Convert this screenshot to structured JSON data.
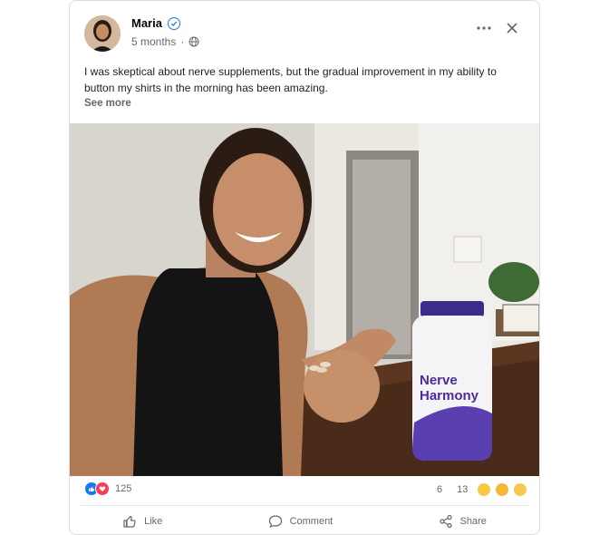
{
  "post": {
    "author": "Maria",
    "time": "5 months",
    "separator": "·",
    "text": "I was skeptical about nerve supplements, but the gradual improvement in my ability to button my shirts in the morning has been amazing.",
    "see_more": "See more"
  },
  "photo": {
    "bottle_line1": "Nerve",
    "bottle_line2": "Harmony"
  },
  "stats": {
    "reaction_count": "125",
    "comments_count": "6",
    "shares_count": "13"
  },
  "actions": {
    "like": "Like",
    "comment": "Comment",
    "share": "Share"
  },
  "colors": {
    "accent": "#1877f2",
    "love": "#f33e58",
    "bottle_purple": "#4b2c9e"
  }
}
